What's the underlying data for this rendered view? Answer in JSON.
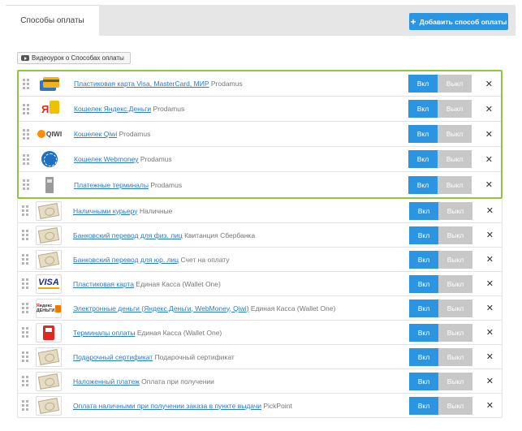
{
  "header": {
    "tab_label": "Способы оплаты",
    "add_button_label": "Добавить способ оплаты",
    "add_button_icon": "plus-icon"
  },
  "video_button_label": "Видеоурок о Способах оплаты",
  "colors": {
    "accent": "#2b95e2",
    "highlight_border": "#8dc63f",
    "off_button": "#c8c8c8"
  },
  "rows": [
    {
      "icon": "bank-cards-icon",
      "link": "Пластиковая карта Visa, MasterCard, МИР",
      "provider": "Prodamus",
      "on_label": "Вкл",
      "off_label": "Выкл",
      "highlighted": true
    },
    {
      "icon": "yandex-money-icon",
      "link": "Кошелек Яндекс.Деньги",
      "provider": "Prodamus",
      "on_label": "Вкл",
      "off_label": "Выкл",
      "highlighted": true
    },
    {
      "icon": "qiwi-icon",
      "link": "Кошелек Qiwi",
      "provider": "Prodamus",
      "on_label": "Вкл",
      "off_label": "Выкл",
      "highlighted": true,
      "logo_text": "QIWI"
    },
    {
      "icon": "webmoney-icon",
      "link": "Кошелек Webmoney",
      "provider": "Prodamus",
      "on_label": "Вкл",
      "off_label": "Выкл",
      "highlighted": true
    },
    {
      "icon": "payment-terminal-icon",
      "link": "Платежные терминалы",
      "provider": "Prodamus",
      "on_label": "Вкл",
      "off_label": "Выкл",
      "highlighted": true
    },
    {
      "icon": "cash-icon",
      "link": "Наличными курьеру",
      "provider": "Наличные",
      "on_label": "Вкл",
      "off_label": "Выкл",
      "highlighted": false
    },
    {
      "icon": "cash-icon",
      "link": "Банковский перевод для физ. лиц",
      "provider": "Квитанция Сбербанка",
      "on_label": "Вкл",
      "off_label": "Выкл",
      "highlighted": false
    },
    {
      "icon": "cash-icon",
      "link": "Банковский перевод для юр. лиц",
      "provider": "Счет на оплату",
      "on_label": "Вкл",
      "off_label": "Выкл",
      "highlighted": false
    },
    {
      "icon": "visa-icon",
      "link": "Пластиковая карта",
      "provider": "Единая Касса (Wallet One)",
      "on_label": "Вкл",
      "off_label": "Выкл",
      "highlighted": false,
      "logo_text": "VISA"
    },
    {
      "icon": "yandex-dengi-icon",
      "link": "Электронные деньги (Яндекс.Деньги, WebMoney, Qiwi)",
      "provider": "Единая Касса (Wallet One)",
      "on_label": "Вкл",
      "off_label": "Выкл",
      "highlighted": false
    },
    {
      "icon": "red-terminal-icon",
      "link": "Терминалы оплаты",
      "provider": "Единая Касса (Wallet One)",
      "on_label": "Вкл",
      "off_label": "Выкл",
      "highlighted": false
    },
    {
      "icon": "cash-icon",
      "link": "Подарочный сертификат",
      "provider": "Подарочный сертификат",
      "on_label": "Вкл",
      "off_label": "Выкл",
      "highlighted": false
    },
    {
      "icon": "cash-icon",
      "link": "Наложенный платеж",
      "provider": "Оплата при получении",
      "on_label": "Вкл",
      "off_label": "Выкл",
      "highlighted": false
    },
    {
      "icon": "cash-icon",
      "link": "Оплата наличными при получении заказа в пункте выдачи",
      "provider": "PickPoint",
      "on_label": "Вкл",
      "off_label": "Выкл",
      "highlighted": false
    }
  ]
}
